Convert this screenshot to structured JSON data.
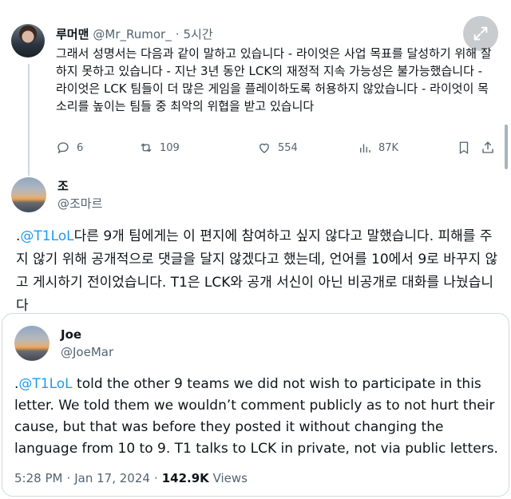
{
  "reply": {
    "name": "루머맨",
    "handle": "@Mr_Rumor_",
    "separator": "·",
    "time": "5시간",
    "text": "그래서 성명서는 다음과 같이 말하고 있습니다 - 라이엇은 사업 목표를 달성하기 위해 잘하지 못하고 있습니다 - 지난 3년 동안 LCK의 재정적 지속 가능성은 불가능했습니다 - 라이엇은 LCK 팀들이 더 많은 게임을 플레이하도록 허용하지 않았습니다 - 라이엇이 목소리를 높이는 팀들 중 최악의 위협을 받고 있습니다",
    "actions": {
      "replies": "6",
      "retweets": "109",
      "likes": "554",
      "views": "87K"
    }
  },
  "quote_tweet": {
    "name": "조",
    "handle": "@조마르",
    "prefix": ".",
    "mention": "@T1LoL",
    "text": "다른 9개 팀에게는 이 편지에 참여하고 싶지 않다고 말했습니다. 피해를 주지 않기 위해 공개적으로 댓글을 달지 않겠다고 했는데, 언어를 10에서 9로 바꾸지 않고 게시하기 전이었습니다. T1은 LCK와 공개 서신이 아닌 비공개로 대화를 나눴습니다"
  },
  "quoted_tweet": {
    "name": "Joe",
    "handle": "@JoeMar",
    "prefix": ".",
    "mention": "@T1LoL",
    "text": " told the other 9 teams we did not wish to participate in this letter.  We told them we wouldn’t comment publicly as to not hurt their cause, but that was before they posted it without changing the language from 10 to 9. T1 talks to LCK in private, not via public letters.",
    "time": "5:28 PM",
    "separator1": "·",
    "date": "Jan 17, 2024",
    "separator2": "·",
    "views_count": "142.9K",
    "views_label": "Views"
  },
  "colors": {
    "link": "#1d9bf0",
    "secondary_text": "#536471",
    "border": "#cfd9de"
  },
  "icons": [
    "expand-icon",
    "reply-icon",
    "retweet-icon",
    "like-icon",
    "views-icon",
    "bookmark-icon",
    "share-icon"
  ]
}
